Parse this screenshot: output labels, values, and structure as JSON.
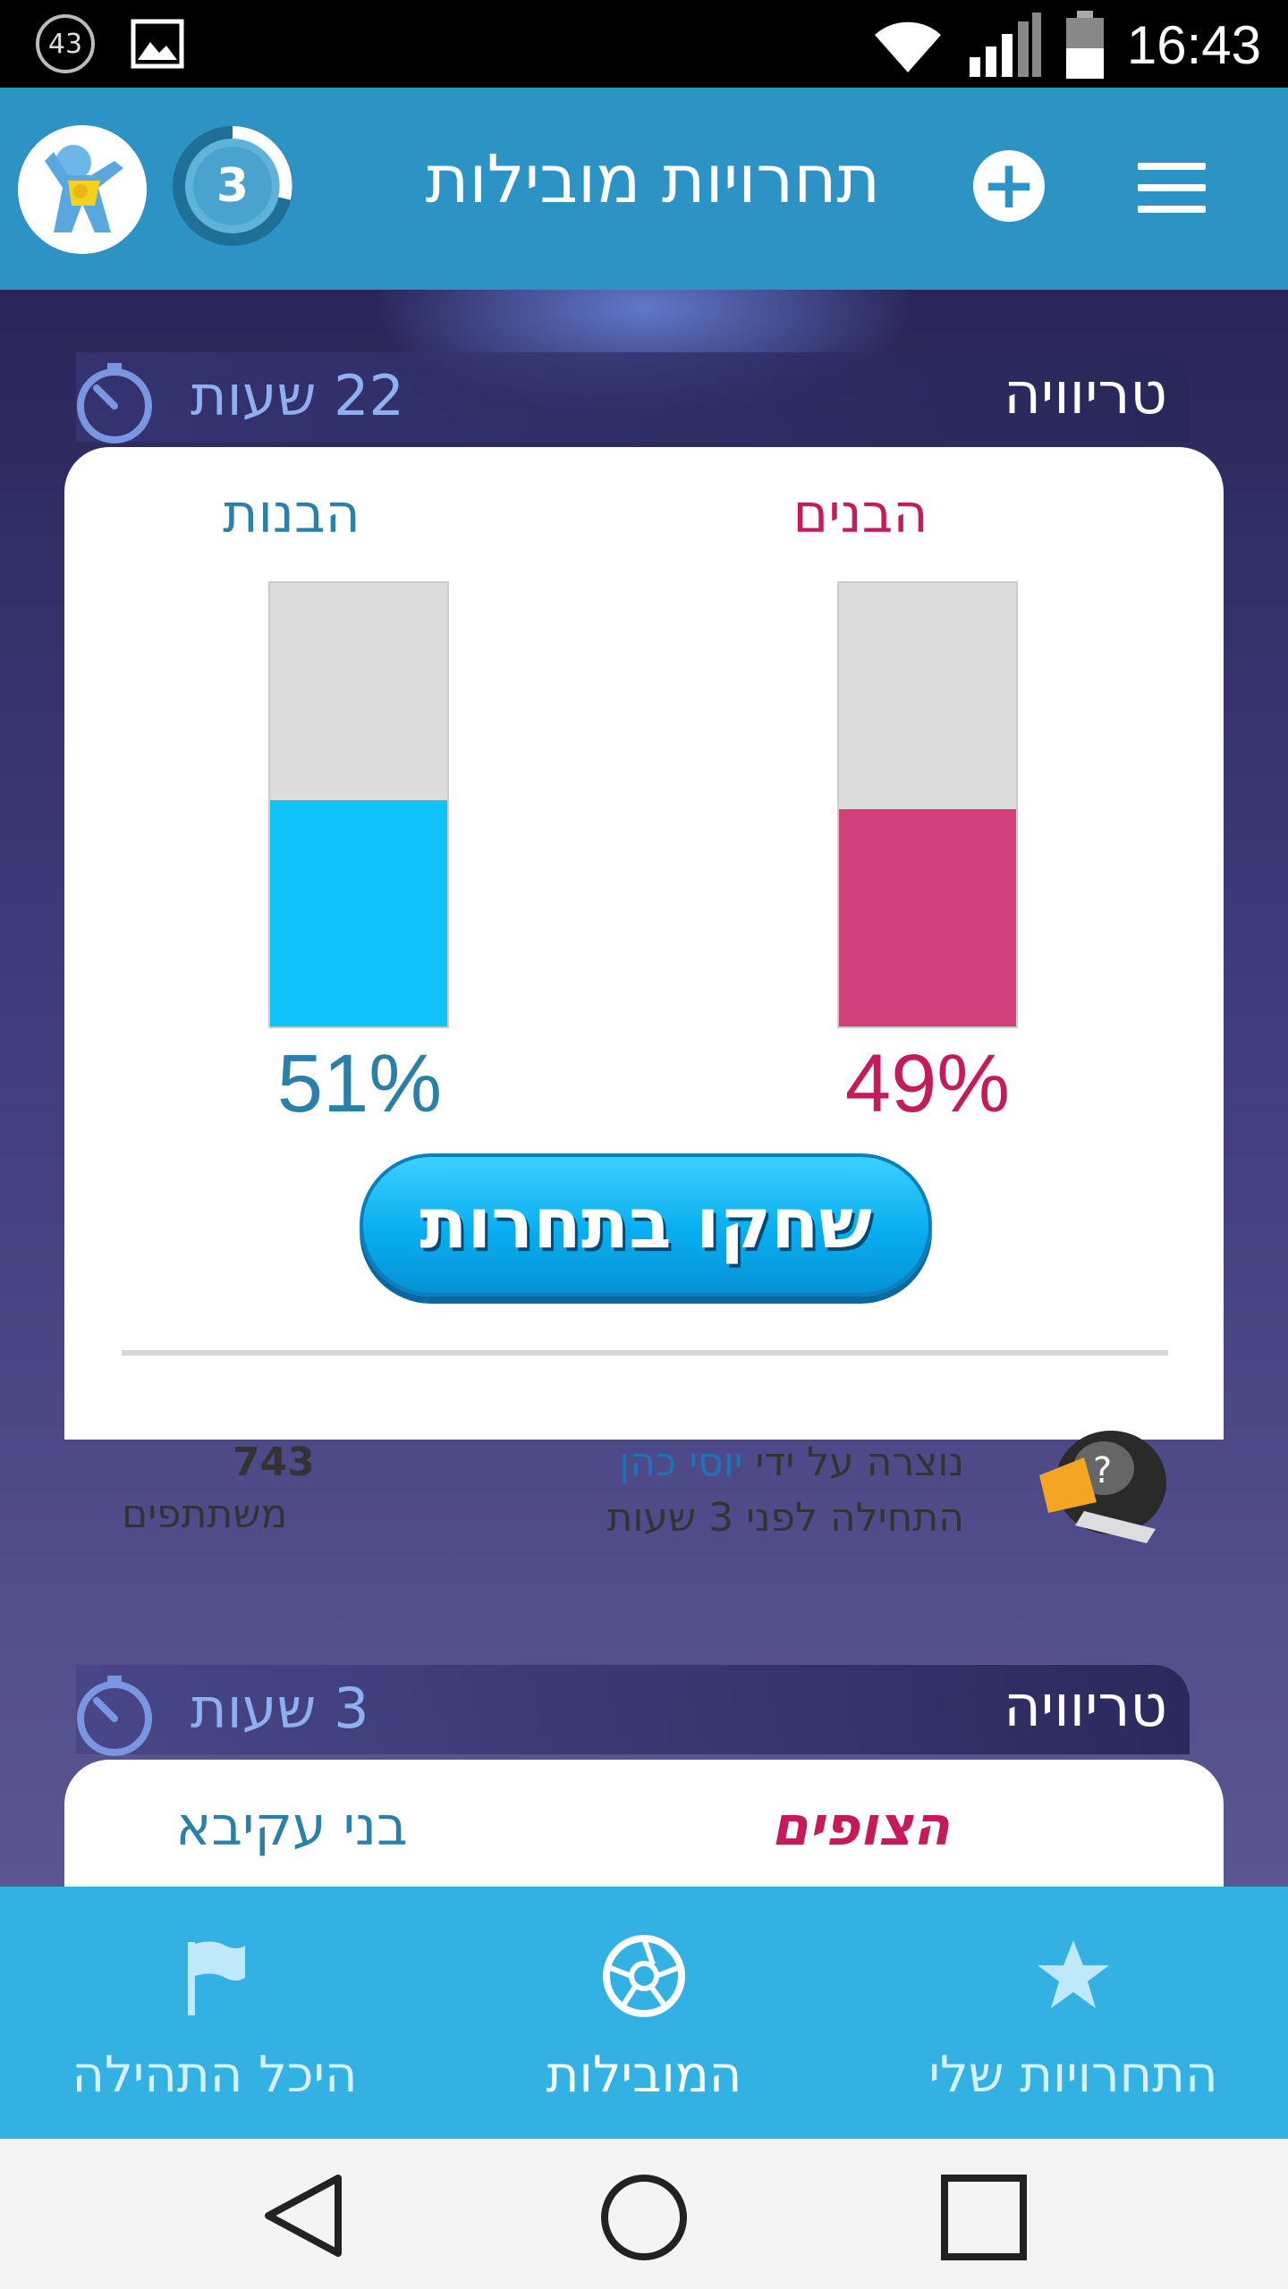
{
  "status_bar": {
    "notification_count": "43",
    "clock": "16:43"
  },
  "header": {
    "level": "3",
    "title": "תחרויות מובילות",
    "plus_symbol": "+"
  },
  "competitions": [
    {
      "category": "טריוויה",
      "time_left": "22 שעות",
      "team_right": {
        "name": "הבנים",
        "percent_label": "49%",
        "percent": 49,
        "color": "#d1427a",
        "text_color": "#c41b5c"
      },
      "team_left": {
        "name": "הבנות",
        "percent_label": "51%",
        "percent": 51,
        "color": "#0fc3f8",
        "text_color": "#2b7fa8"
      },
      "play_label": "שחקו בתחרות",
      "created_by_prefix": "נוצרה על ידי",
      "creator_name": "יוסי כהן",
      "started": "התחילה לפני 3 שעות",
      "participants_count": "743",
      "participants_label": "משתתפים"
    },
    {
      "category": "טריוויה",
      "time_left": "3 שעות",
      "team_right": {
        "name": "הצופים",
        "text_color": "#c41b5c"
      },
      "team_left": {
        "name": "בני עקיבא",
        "text_color": "#2b7fa8"
      }
    }
  ],
  "bottom_nav": [
    {
      "label": "היכל התהילה",
      "icon": "flag-icon",
      "active": false
    },
    {
      "label": "המובילות",
      "icon": "aperture-icon",
      "active": true
    },
    {
      "label": "התחרויות שלי",
      "icon": "star-icon",
      "active": false
    }
  ],
  "colors": {
    "header_bg": "#2c93c4",
    "nav_bg": "#33b1e3",
    "boys": "#d1427a",
    "girls": "#0fc3f8"
  }
}
